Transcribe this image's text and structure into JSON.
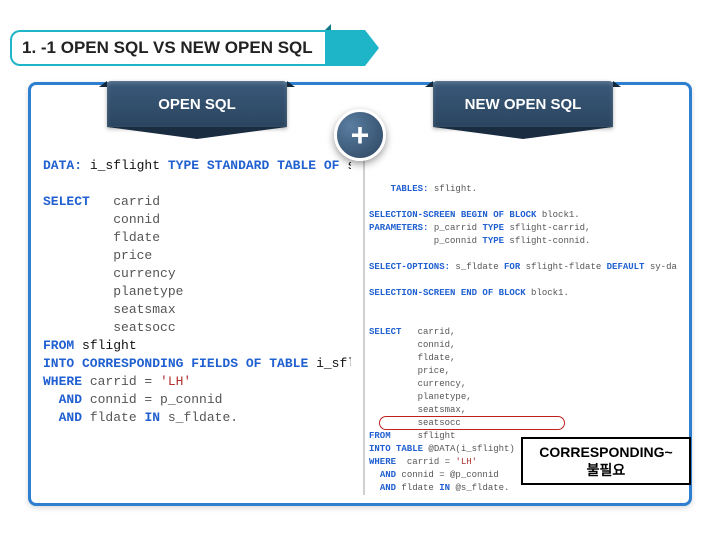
{
  "title": "1. -1 OPEN SQL VS NEW OPEN SQL",
  "left": {
    "banner": "OPEN SQL",
    "code_html": "<span class='kw'>DATA:</span> <span class='id'>i_sflight</span> <span class='kw'>TYPE STANDARD TABLE OF</span> <span class='id'>sflight</span>.\n\n<span class='kw'>SELECT</span>   carrid\n         connid\n         fldate\n         price\n         currency\n         planetype\n         seatsmax\n         seatsocc\n<span class='kw'>FROM</span> <span class='id'>sflight</span>\n<span class='kw'>INTO CORRESPONDING FIELDS OF TABLE</span> <span class='id'>i_sflight</span>\n<span class='kw'>WHERE</span> carrid = <span class='str'>'LH'</span>\n  <span class='kw'>AND</span> connid = p_connid\n  <span class='kw'>AND</span> fldate <span class='kw'>IN</span> s_fldate."
  },
  "right": {
    "banner": "NEW OPEN SQL",
    "code_html": "<span class='kw'>TABLES:</span> sflight.\n\n<span class='kw'>SELECTION-SCREEN BEGIN OF BLOCK</span> block1.\n<span class='kw'>PARAMETERS:</span> p_carrid <span class='kw'>TYPE</span> sflight-carrid,\n            p_connid <span class='kw'>TYPE</span> sflight-connid.\n\n<span class='kw'>SELECT-OPTIONS:</span> s_fldate <span class='kw'>FOR</span> sflight-fldate <span class='kw'>DEFAULT</span> sy-datum.\n\n<span class='kw'>SELECTION-SCREEN END OF BLOCK</span> block1.\n\n\n<span class='kw'>SELECT</span>   carrid,\n         connid,\n         fldate,\n         price,\n         currency,\n         planetype,\n         seatsmax,\n         seatsocc\n<span class='kw'>FROM</span>     sflight\n<span class='kw'>INTO TABLE</span> @DATA(i_sflight)\n<span class='kw'>WHERE</span>  carrid = <span class='str'>'LH'</span>\n  <span class='kw'>AND</span> connid = @p_connid\n  <span class='kw'>AND</span> fldate <span class='kw'>IN</span> @s_fldate."
  },
  "plus": "+",
  "note": "CORRESPONDING~\n불필요"
}
